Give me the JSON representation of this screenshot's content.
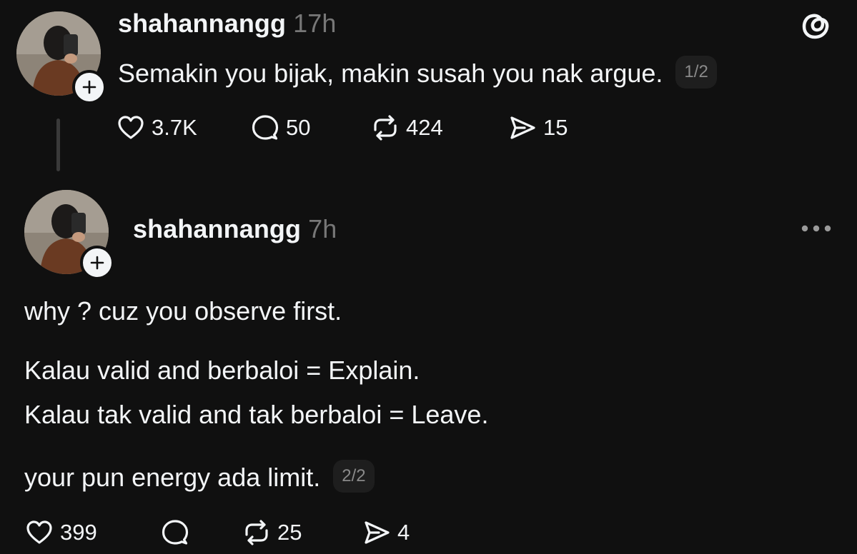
{
  "post1": {
    "username": "shahannangg",
    "time": "17h",
    "text": "Semakin you bijak, makin susah you nak argue.",
    "page": "1/2",
    "likes": "3.7K",
    "replies": "50",
    "reposts": "424",
    "shares": "15"
  },
  "post2": {
    "username": "shahannangg",
    "time": "7h",
    "lines": [
      "why ? cuz you observe first.",
      "Kalau valid and berbaloi = Explain.",
      "Kalau tak valid and tak berbaloi = Leave.",
      "your pun energy ada limit."
    ],
    "page": "2/2",
    "likes": "399",
    "replies": "",
    "reposts": "25",
    "shares": "4"
  },
  "icons": {
    "brand": "threads-logo-icon",
    "like": "heart-icon",
    "reply": "comment-icon",
    "repost": "repost-icon",
    "share": "send-icon",
    "follow": "plus-icon",
    "menu": "more-horizontal-icon"
  },
  "colors": {
    "background": "#101010",
    "text": "#f3f5f7",
    "muted": "#777777",
    "badge_bg": "#1e1e1e"
  }
}
